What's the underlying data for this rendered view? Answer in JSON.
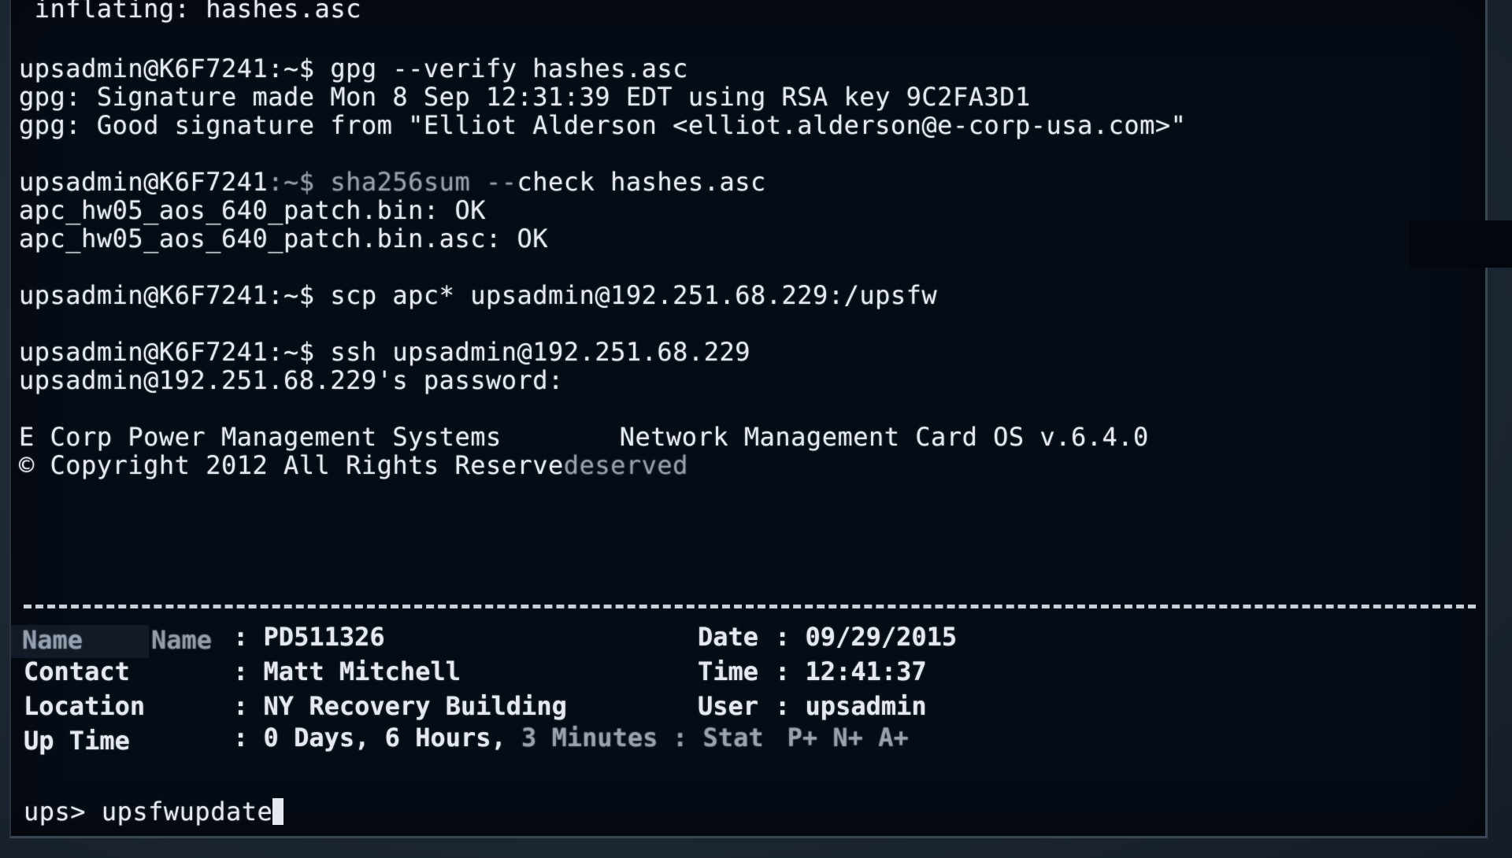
{
  "lines": {
    "l1": " inflating: hashes.asc",
    "l2": "upsadmin@K6F7241:~$ gpg --verify hashes.asc",
    "l3": "gpg: Signature made Mon 8 Sep 12:31:39 EDT using RSA key 9C2FA3D1",
    "l4": "gpg: Good signature from \"Elliot Alderson <elliot.alderson@e-corp-usa.com>\"",
    "l5_prefix": "upsadmin@K6F7241",
    "l5_ghost": ":~$ sha256sum --",
    "l5_suffix": "check hashes.asc",
    "l6": "apc_hw05_aos_640_patch.bin: OK",
    "l7": "apc_hw05_aos_640_patch.bin.asc: OK",
    "l8": "upsadmin@K6F7241:~$ scp apc* upsadmin@192.251.68.229:/upsfw",
    "l9": "upsadmin@K6F7241:~$ ssh upsadmin@192.251.68.229",
    "l10": "upsadmin@192.251.68.229's password:",
    "l11_left": "E Corp Power Management Systems",
    "l11_right": "Network Management Card OS v.6.4.0",
    "l12_main": "© Copyright 2012 All Rights Reserve",
    "l12_ghost": "deserved"
  },
  "info": {
    "name_ghost": "Name",
    "name_label": "Name",
    "name_value": ": PD511326",
    "contact_label": "Contact",
    "contact_value": ": Matt Mitchell",
    "location_label": "Location",
    "location_value": ": NY Recovery Building",
    "uptime_label": "Up Time",
    "uptime_value": ": 0 Days, 6 Hours, ",
    "uptime_ghost": "3 Minutes",
    "date_label": "Date",
    "date_value": ": 09/29/2015",
    "time_label": "Time",
    "time_value": ": 12:41:37",
    "user_label": "User",
    "user_value": ": upsadmin",
    "stat_ghost": ": Stat",
    "stat_value": "P+ N+ A+"
  },
  "prompt": {
    "text": "ups> upsfwupdate"
  }
}
